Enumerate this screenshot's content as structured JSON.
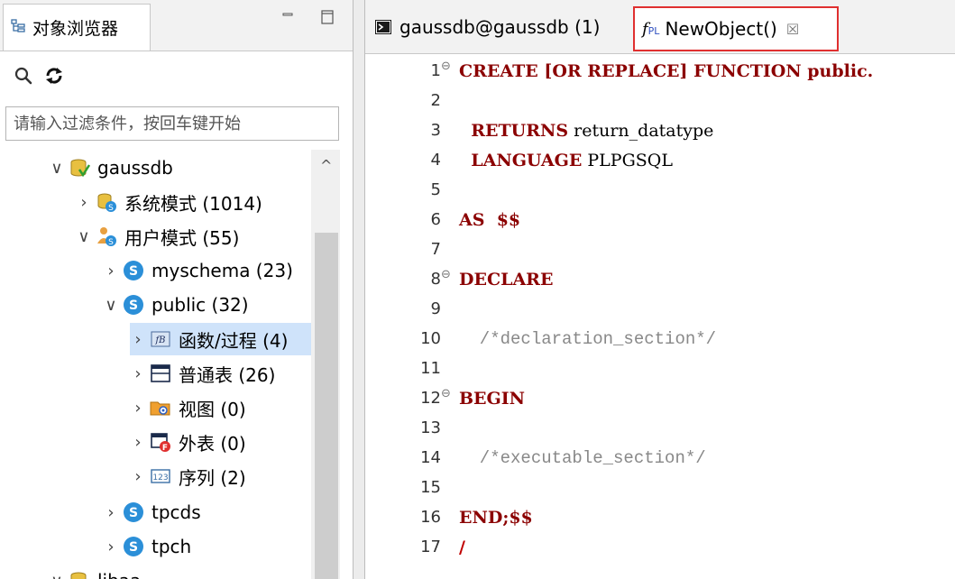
{
  "left_panel": {
    "tab_title": "对象浏览器",
    "filter_placeholder": "请输入过滤条件，按回车键开始",
    "tree": [
      {
        "label": "gaussdb",
        "chevron": "∨"
      },
      {
        "label": "系统模式 (1014)",
        "chevron": "›"
      },
      {
        "label": "用户模式 (55)",
        "chevron": "∨"
      },
      {
        "label": "myschema (23)",
        "chevron": "›"
      },
      {
        "label": "public (32)",
        "chevron": "∨"
      },
      {
        "label": "函数/过程 (4)",
        "chevron": "›",
        "selected": true
      },
      {
        "label": "普通表 (26)",
        "chevron": "›"
      },
      {
        "label": "视图 (0)",
        "chevron": "›"
      },
      {
        "label": "外表 (0)",
        "chevron": "›"
      },
      {
        "label": "序列 (2)",
        "chevron": "›"
      },
      {
        "label": "tpcds",
        "chevron": "›"
      },
      {
        "label": "tpch",
        "chevron": "›"
      },
      {
        "label": "libaa",
        "chevron": "∨"
      }
    ]
  },
  "editor_tabs": {
    "tab1": "gaussdb@gaussdb (1)",
    "tab2": "NewObject()",
    "tab2_icon_f": "f",
    "tab2_icon_pl": "PL",
    "tab2_close": "☒"
  },
  "code_lines": [
    {
      "num": "1",
      "text": "CREATE [OR REPLACE] FUNCTION public."
    },
    {
      "num": "2",
      "text": ""
    },
    {
      "num": "3",
      "text": "  RETURNS return_datatype"
    },
    {
      "num": "4",
      "text": "  LANGUAGE PLPGSQL"
    },
    {
      "num": "5",
      "text": ""
    },
    {
      "num": "6",
      "text": "AS  $$"
    },
    {
      "num": "7",
      "text": ""
    },
    {
      "num": "8",
      "text": "DECLARE"
    },
    {
      "num": "9",
      "text": ""
    },
    {
      "num": "10",
      "text": "  /*declaration_section*/"
    },
    {
      "num": "11",
      "text": ""
    },
    {
      "num": "12",
      "text": "BEGIN"
    },
    {
      "num": "13",
      "text": ""
    },
    {
      "num": "14",
      "text": "  /*executable_section*/"
    },
    {
      "num": "15",
      "text": ""
    },
    {
      "num": "16",
      "text": "END;$$"
    },
    {
      "num": "17",
      "text": "/"
    }
  ],
  "colors": {
    "keyword": "#8b0000",
    "comment": "#888888",
    "selection": "#cfe3fa",
    "highlight_border": "#e03030"
  }
}
